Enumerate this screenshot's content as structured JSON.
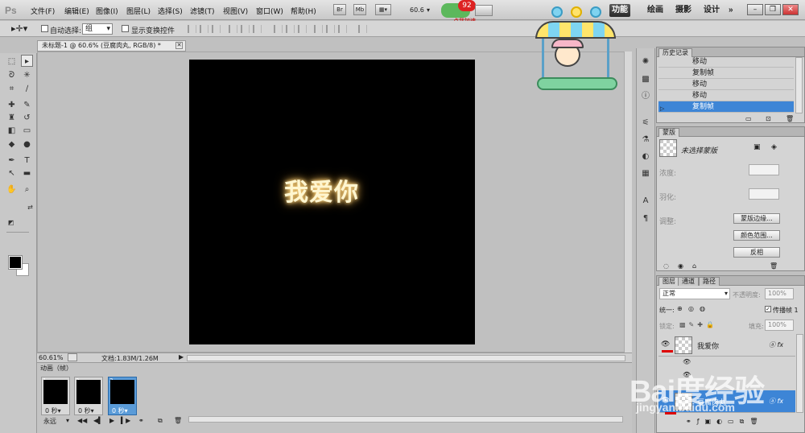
{
  "menubar": {
    "logo": "Ps",
    "menus": [
      "文件(F)",
      "编辑(E)",
      "图像(I)",
      "图层(L)",
      "选择(S)",
      "滤镜(T)",
      "视图(V)",
      "窗口(W)",
      "帮助(H)"
    ],
    "mini_buttons": [
      "Br",
      "Mb"
    ],
    "zoom": "60.6",
    "workspaces": [
      "功能",
      "绘画",
      "摄影",
      "设计",
      "»"
    ],
    "active_workspace": "功能",
    "notification_count": "92",
    "notification_label": "点我加速"
  },
  "options": {
    "auto_select_label": "自动选择:",
    "auto_select_value": "组",
    "show_transform_label": "显示变换控件"
  },
  "document": {
    "tab_title": "未标题-1 @ 60.6% (豆腐肉丸, RGB/8) *",
    "canvas_text": "我爱你",
    "zoom_status": "60.61%",
    "doc_info": "文档:1.83M/1.26M"
  },
  "animation": {
    "title": "动画（帧）",
    "frames": [
      {
        "num": "1",
        "delay": "0 秒▾"
      },
      {
        "num": "2",
        "delay": "0 秒▾"
      },
      {
        "num": "3",
        "delay": "0 秒▾"
      }
    ],
    "loop": "永远"
  },
  "history": {
    "tab": "历史记录",
    "items": [
      "移动",
      "复制帧",
      "移动",
      "移动",
      "复制帧"
    ],
    "selected_index": 4
  },
  "masks": {
    "tab": "蒙版",
    "no_mask": "未选择蒙版",
    "density_label": "浓度:",
    "feather_label": "羽化:",
    "refine_label": "调整:",
    "mask_edge": "蒙版边缘...",
    "color_range": "颜色范围...",
    "invert": "反相"
  },
  "layers": {
    "tabs": [
      "图层",
      "通道",
      "路径"
    ],
    "blend_mode": "正常",
    "opacity_label": "不透明度:",
    "opacity_value": "100%",
    "unify_label": "统一:",
    "propagate_label": "传播帧 1",
    "lock_label": "锁定:",
    "fill_label": "填充:",
    "fill_value": "100%",
    "items": [
      {
        "name": "我爱你"
      },
      {
        "name": "豆腐肉丸"
      }
    ]
  },
  "watermark": {
    "brand": "Bai度经验",
    "url": "jingyan.baidu.com"
  }
}
